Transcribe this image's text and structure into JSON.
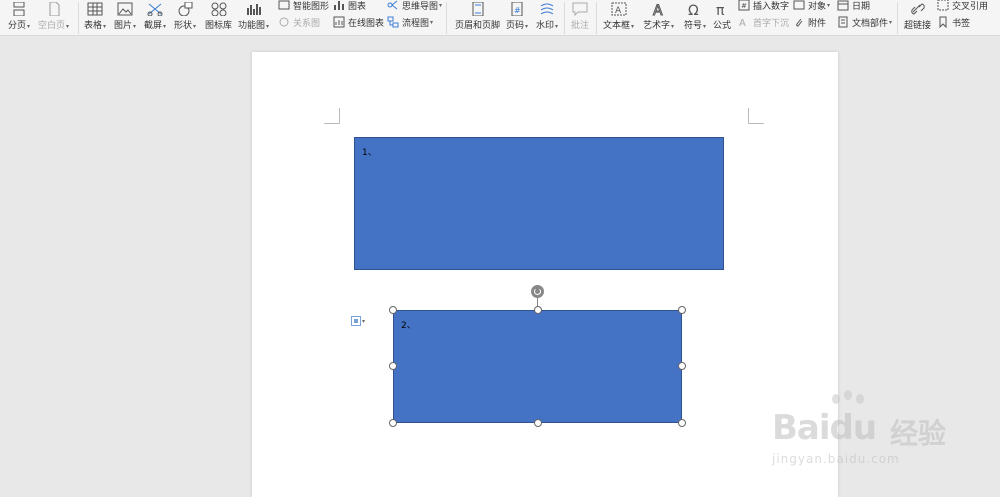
{
  "ribbon": {
    "big": [
      {
        "id": "page-break",
        "label": "分页",
        "caret": true,
        "disabled": false
      },
      {
        "id": "blank-page",
        "label": "空白页",
        "caret": true,
        "disabled": true
      },
      {
        "id": "table",
        "label": "表格",
        "caret": true,
        "disabled": false
      },
      {
        "id": "picture",
        "label": "图片",
        "caret": true,
        "disabled": false
      },
      {
        "id": "screenshot",
        "label": "截屏",
        "caret": true,
        "disabled": false
      },
      {
        "id": "shapes",
        "label": "形状",
        "caret": true,
        "disabled": false
      },
      {
        "id": "icon-library",
        "label": "图标库",
        "caret": false,
        "disabled": false
      },
      {
        "id": "function-chart",
        "label": "功能图",
        "caret": true,
        "disabled": false
      },
      {
        "id": "header-footer",
        "label": "页眉和页脚",
        "caret": false,
        "disabled": false
      },
      {
        "id": "page-number",
        "label": "页码",
        "caret": true,
        "disabled": false
      },
      {
        "id": "watermark",
        "label": "水印",
        "caret": true,
        "disabled": false
      },
      {
        "id": "comment",
        "label": "批注",
        "caret": false,
        "disabled": true
      },
      {
        "id": "text-box",
        "label": "文本框",
        "caret": true,
        "disabled": false
      },
      {
        "id": "word-art",
        "label": "艺术字",
        "caret": true,
        "disabled": false
      },
      {
        "id": "symbol",
        "label": "符号",
        "caret": true,
        "disabled": false
      },
      {
        "id": "formula",
        "label": "公式",
        "caret": false,
        "disabled": false
      },
      {
        "id": "hyperlink",
        "label": "超链接",
        "caret": false,
        "disabled": false
      }
    ],
    "small": [
      {
        "id": "smart-graphic",
        "label": "智能图形",
        "caret": false,
        "disabled": false
      },
      {
        "id": "relation-chart",
        "label": "关系图",
        "caret": false,
        "disabled": true
      },
      {
        "id": "chart",
        "label": "图表",
        "caret": false,
        "disabled": false
      },
      {
        "id": "online-chart",
        "label": "在线图表",
        "caret": false,
        "disabled": false
      },
      {
        "id": "mind-map",
        "label": "思维导图",
        "caret": true,
        "disabled": false
      },
      {
        "id": "flow-chart",
        "label": "流程图",
        "caret": true,
        "disabled": false
      },
      {
        "id": "insert-number",
        "label": "插入数字",
        "caret": false,
        "disabled": false
      },
      {
        "id": "drop-cap",
        "label": "首字下沉",
        "caret": false,
        "disabled": true
      },
      {
        "id": "object",
        "label": "对象",
        "caret": true,
        "disabled": false
      },
      {
        "id": "attachment",
        "label": "附件",
        "caret": false,
        "disabled": false
      },
      {
        "id": "date",
        "label": "日期",
        "caret": false,
        "disabled": false
      },
      {
        "id": "doc-parts",
        "label": "文档部件",
        "caret": true,
        "disabled": false
      },
      {
        "id": "cross-ref",
        "label": "交叉引用",
        "caret": false,
        "disabled": false
      },
      {
        "id": "bookmark",
        "label": "书签",
        "caret": false,
        "disabled": false
      }
    ]
  },
  "document": {
    "shape1_text": "1、",
    "shape2_text": "2、"
  },
  "watermark": {
    "brand": "Baidu",
    "cn": "经验",
    "url": "jingyan.baidu.com"
  },
  "colors": {
    "shape_fill": "#4472c4",
    "shape_border": "#2f528f",
    "ribbon_bg": "#f5f5f5",
    "canvas_bg": "#e8e8e8"
  }
}
